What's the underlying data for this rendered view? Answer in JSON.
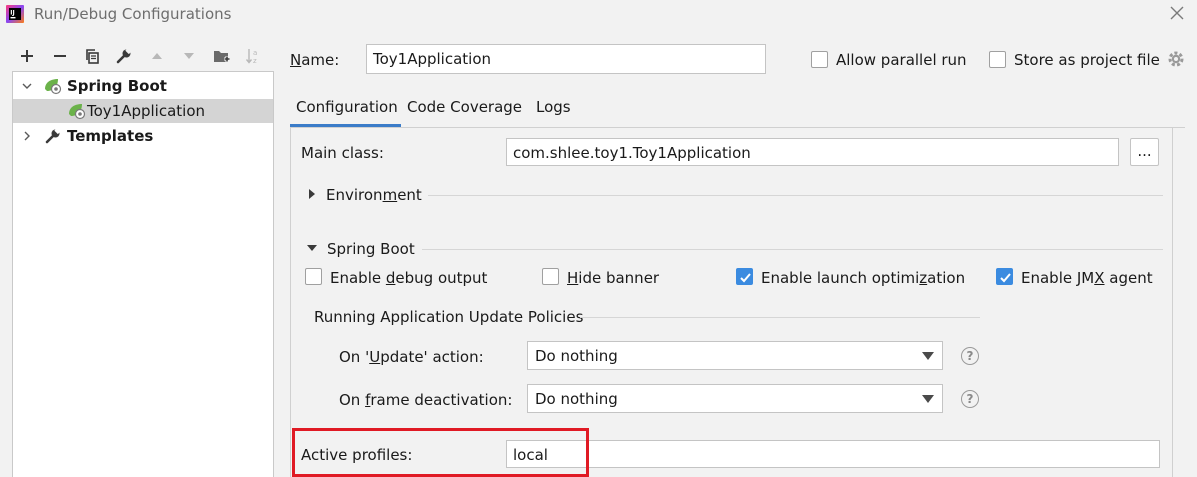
{
  "window": {
    "title": "Run/Debug Configurations"
  },
  "toolbar": {
    "icons": [
      "plus-icon",
      "minus-icon",
      "copy-icon",
      "wrench-icon",
      "arrow-up-icon",
      "arrow-down-icon",
      "folder-add-icon",
      "sort-icon"
    ]
  },
  "tree": {
    "items": [
      {
        "label": "Spring Boot",
        "expanded": true,
        "bold": true,
        "icon": "spring-boot-icon"
      },
      {
        "label": "Toy1Application",
        "selected": true,
        "icon": "spring-boot-app-icon"
      },
      {
        "label": "Templates",
        "expanded": false,
        "bold": true,
        "icon": "wrench-icon"
      }
    ]
  },
  "header": {
    "name_label": "Name:",
    "name_value": "Toy1Application",
    "allow_parallel_label": "Allow parallel run",
    "allow_parallel_checked": false,
    "store_label": "Store as project file",
    "store_checked": false
  },
  "tabs": [
    {
      "label": "Configuration",
      "active": true
    },
    {
      "label": "Code Coverage",
      "active": false
    },
    {
      "label": "Logs",
      "active": false
    }
  ],
  "configuration": {
    "main_class_label": "Main class:",
    "main_class_value": "com.shlee.toy1.Toy1Application",
    "browse_label": "...",
    "environment_label": "Environment",
    "spring_boot_label": "Spring Boot",
    "checkboxes": [
      {
        "label": "Enable debug output",
        "checked": false
      },
      {
        "label": "Hide banner",
        "checked": false
      },
      {
        "label": "Enable launch optimization",
        "checked": true
      },
      {
        "label": "Enable JMX agent",
        "checked": true
      }
    ],
    "update_policies_label": "Running Application Update Policies",
    "on_update_label": "On 'Update' action:",
    "on_update_value": "Do nothing",
    "on_frame_label": "On frame deactivation:",
    "on_frame_value": "Do nothing",
    "help_glyph": "?",
    "active_profiles_label": "Active profiles:",
    "active_profiles_value": "local"
  },
  "colors": {
    "accent": "#3b8be0",
    "highlight": "#e01a24",
    "selection": "#d4d4d4"
  }
}
